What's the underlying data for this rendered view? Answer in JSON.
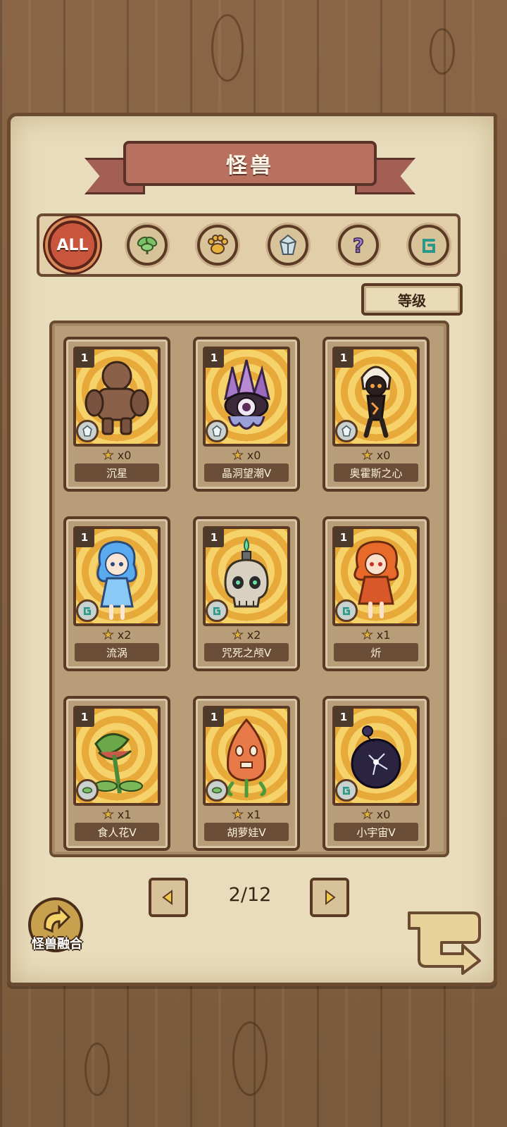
{
  "title": "怪兽",
  "filters": [
    {
      "label": "ALL",
      "icon": "all-icon",
      "active": true
    },
    {
      "label": "",
      "icon": "leaf-icon",
      "active": false
    },
    {
      "label": "",
      "icon": "paw-icon",
      "active": false
    },
    {
      "label": "",
      "icon": "crystal-icon",
      "active": false
    },
    {
      "label": "",
      "icon": "question-icon",
      "active": false
    },
    {
      "label": "",
      "icon": "spiral-icon",
      "active": false
    }
  ],
  "sort_label": "等级",
  "cards": [
    {
      "level": "1",
      "count": "x0",
      "name": "沉星",
      "element": "crystal-icon"
    },
    {
      "level": "1",
      "count": "x0",
      "name": "晶洞望潮V",
      "element": "crystal-icon"
    },
    {
      "level": "1",
      "count": "x0",
      "name": "奥霍斯之心",
      "element": "crystal-icon"
    },
    {
      "level": "1",
      "count": "x2",
      "name": "流涡",
      "element": "spiral-icon"
    },
    {
      "level": "1",
      "count": "x2",
      "name": "咒死之颅V",
      "element": "spiral-icon"
    },
    {
      "level": "1",
      "count": "x1",
      "name": "炘",
      "element": "spiral-icon"
    },
    {
      "level": "1",
      "count": "x1",
      "name": "食人花V",
      "element": "leaf-icon"
    },
    {
      "level": "1",
      "count": "x1",
      "name": "胡萝娃V",
      "element": "leaf-icon"
    },
    {
      "level": "1",
      "count": "x0",
      "name": "小宇宙V",
      "element": "spiral-icon"
    }
  ],
  "pager": {
    "text": "2/12"
  },
  "fusion_label": "怪兽融合",
  "colors": {
    "accent": "#c9553d",
    "card_art": "#e7a93a",
    "paper": "#e9dcbc",
    "ink": "#5a3a24"
  }
}
